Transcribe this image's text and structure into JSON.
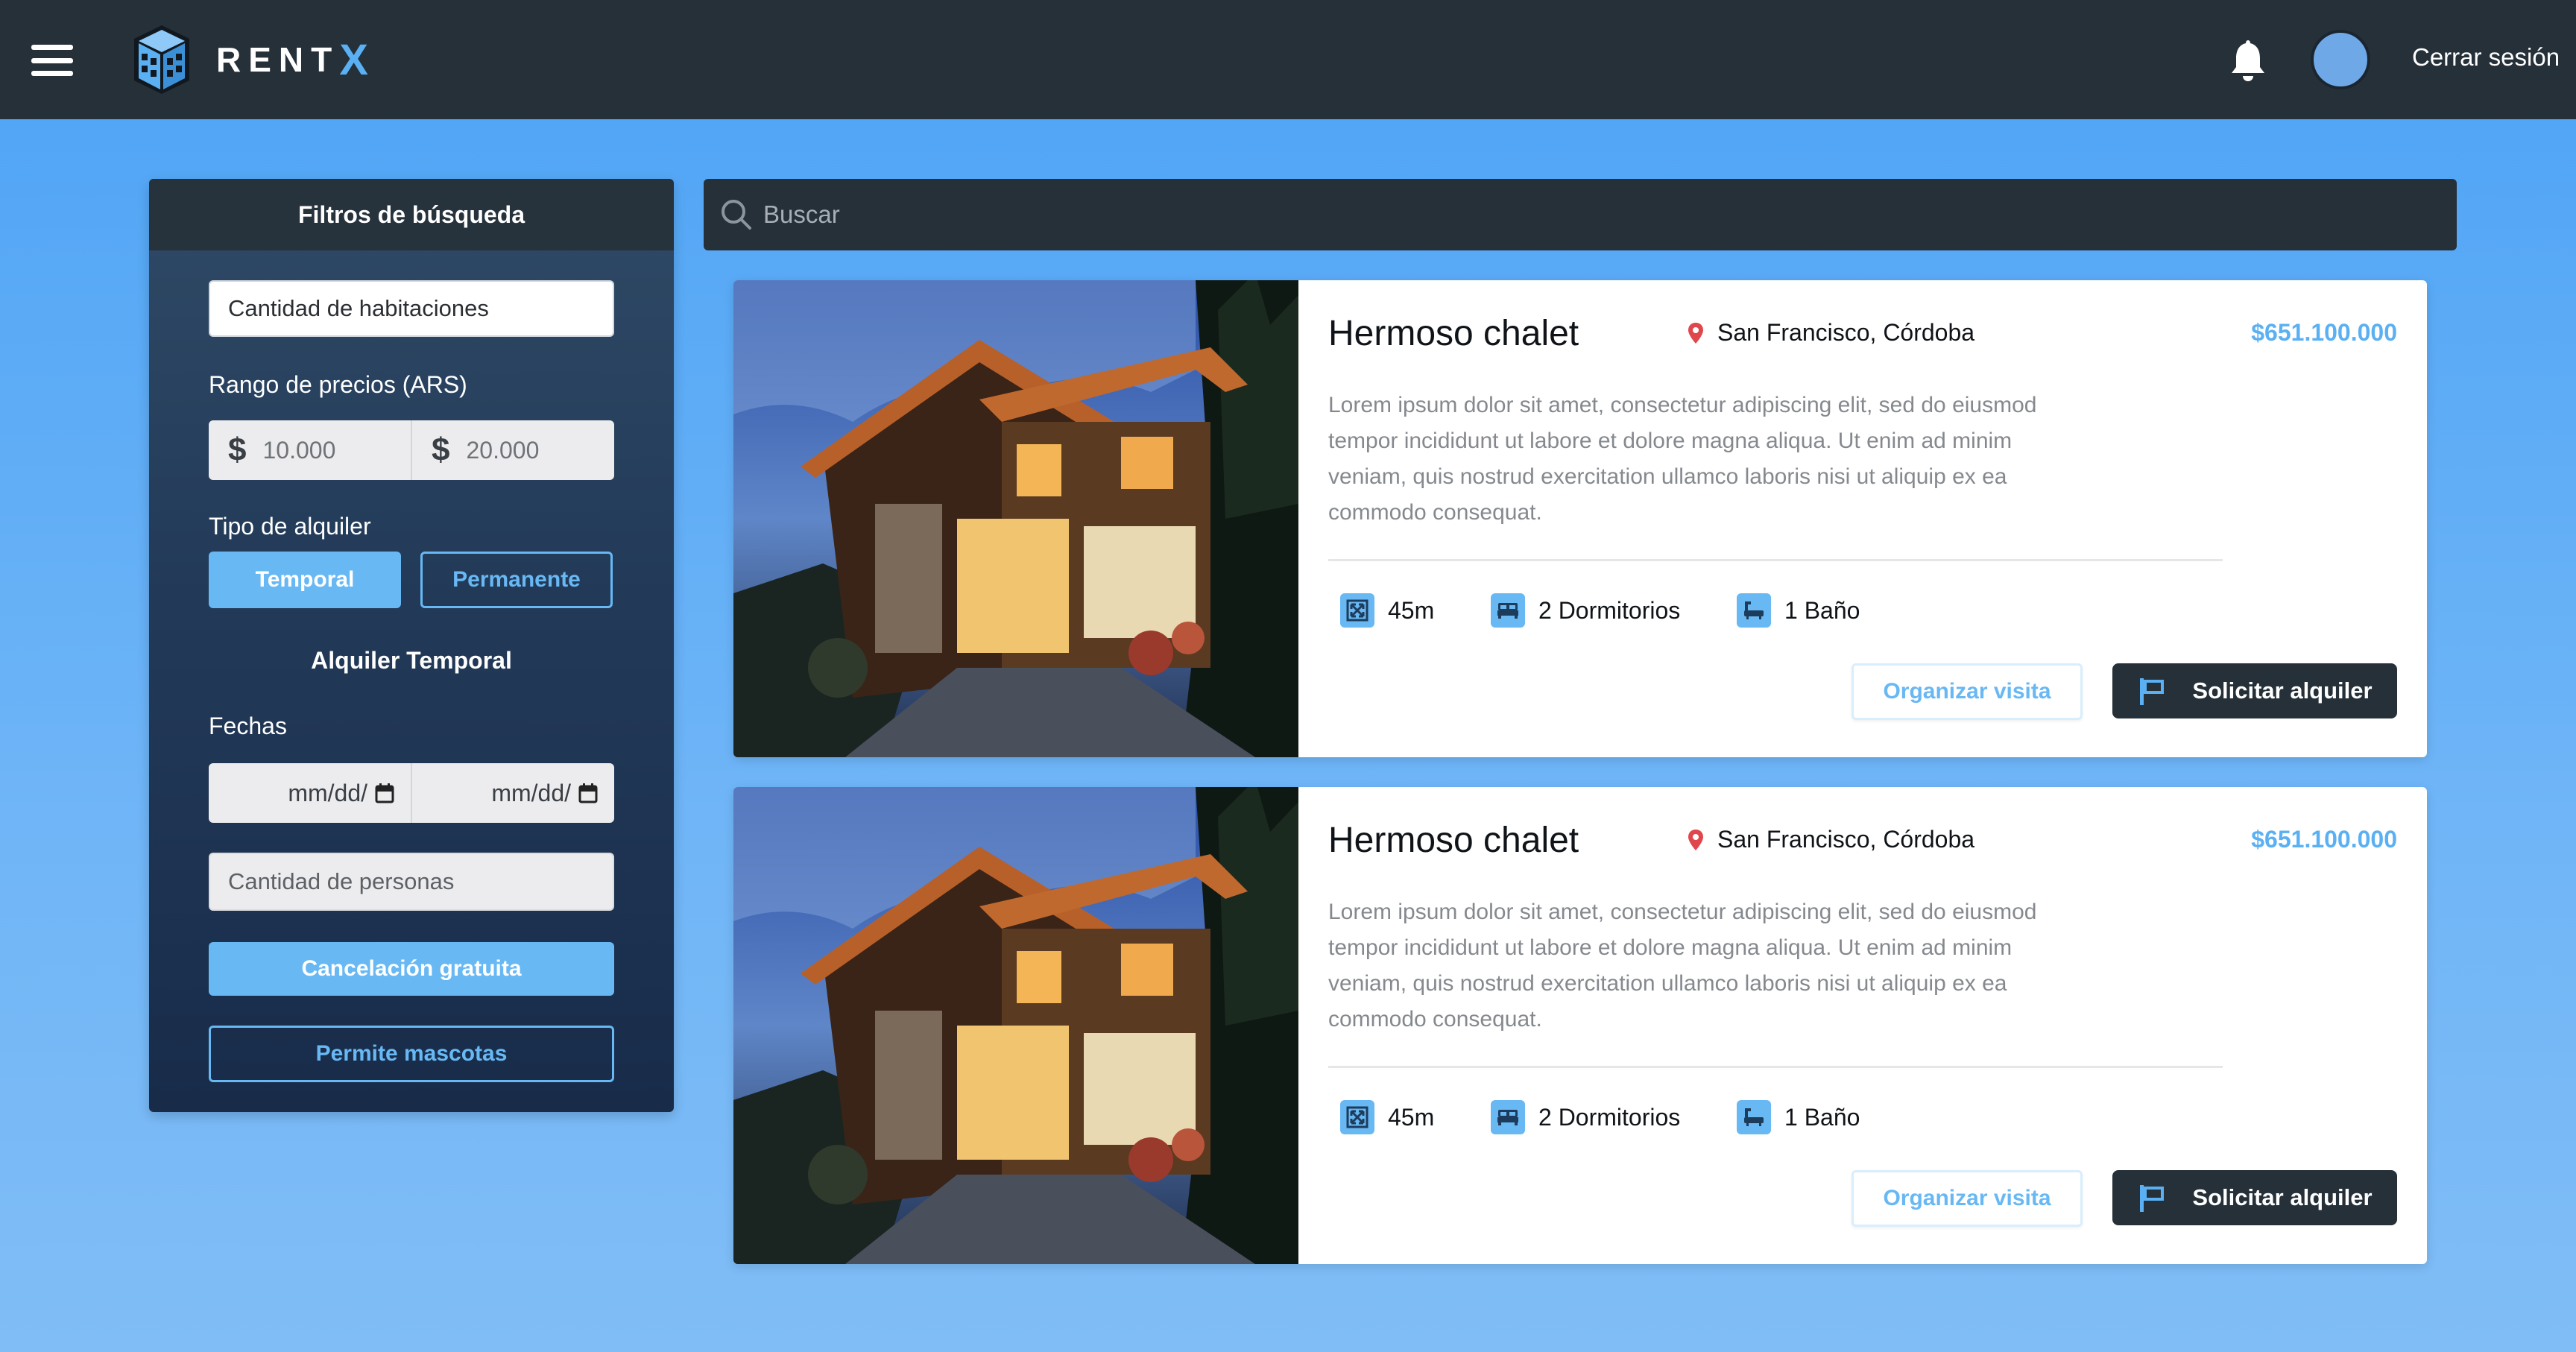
{
  "header": {
    "brand_name": "RENT",
    "brand_accent": "X",
    "logout_label": "Cerrar sesión",
    "icons": [
      "menu-icon",
      "building-logo-icon",
      "bell-icon",
      "avatar"
    ]
  },
  "sidebar": {
    "title": "Filtros de búsqueda",
    "rooms_placeholder": "Cantidad de habitaciones",
    "price_range_label": "Rango de precios (ARS)",
    "price_currency_symbol": "$",
    "price_min": "10.000",
    "price_max": "20.000",
    "rental_type_label": "Tipo de alquiler",
    "rental_type_options": [
      "Temporal",
      "Permanente"
    ],
    "rental_type_selected": "Temporal",
    "temporal_section_title": "Alquiler Temporal",
    "dates_label": "Fechas",
    "date_start_placeholder": "mm/dd/yyyy",
    "date_end_placeholder": "mm/dd/yyyy",
    "date_start_display": "mm/dd/",
    "date_end_display": "mm/dd/",
    "people_placeholder": "Cantidad de personas",
    "free_cancel_label": "Cancelación gratuita",
    "pets_label": "Permite mascotas"
  },
  "search": {
    "placeholder": "Buscar"
  },
  "listings": [
    {
      "title": "Hermoso chalet",
      "location": "San Francisco, Córdoba",
      "price": "$651.100.000",
      "description": "Lorem ipsum dolor sit amet, consectetur adipiscing elit, sed do eiusmod tempor incididunt ut labore et dolore magna aliqua. Ut enim ad minim veniam, quis nostrud exercitation ullamco laboris nisi ut aliquip ex ea commodo consequat.",
      "area": "45m",
      "bedrooms": "2 Dormitorios",
      "bathrooms": "1 Baño",
      "visit_label": "Organizar visita",
      "rent_label": "Solicitar alquiler"
    },
    {
      "title": "Hermoso chalet",
      "location": "San Francisco, Córdoba",
      "price": "$651.100.000",
      "description": "Lorem ipsum dolor sit amet, consectetur adipiscing elit, sed do eiusmod tempor incididunt ut labore et dolore magna aliqua. Ut enim ad minim veniam, quis nostrud exercitation ullamco laboris nisi ut aliquip ex ea commodo consequat.",
      "area": "45m",
      "bedrooms": "2 Dormitorios",
      "bathrooms": "1 Baño",
      "visit_label": "Organizar visita",
      "rent_label": "Solicitar alquiler"
    }
  ],
  "colors": {
    "header_bg": "#253039",
    "accent_blue": "#68b8f4",
    "price_blue": "#5ab0f2",
    "page_bg": "#4da3f5",
    "pin_red": "#e0474c"
  }
}
